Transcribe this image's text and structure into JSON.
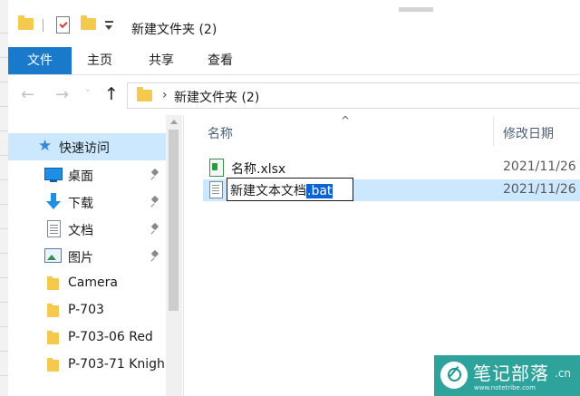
{
  "window": {
    "title": "新建文件夹 (2)"
  },
  "ribbon": {
    "tabs": [
      "文件",
      "主页",
      "共享",
      "查看"
    ],
    "active": "文件"
  },
  "address": {
    "path": [
      "新建文件夹 (2)"
    ]
  },
  "nav_pane": {
    "items": [
      {
        "label": "快速访问",
        "icon": "star-icon",
        "selected": true
      },
      {
        "label": "桌面",
        "icon": "desktop-icon",
        "pinned": true
      },
      {
        "label": "下载",
        "icon": "download-icon",
        "pinned": true
      },
      {
        "label": "文档",
        "icon": "document-icon",
        "pinned": true
      },
      {
        "label": "图片",
        "icon": "picture-icon",
        "pinned": true
      },
      {
        "label": "Camera",
        "icon": "folder-icon"
      },
      {
        "label": "P-703",
        "icon": "folder-icon"
      },
      {
        "label": "P-703-06 Red",
        "icon": "folder-icon"
      },
      {
        "label": "P-703-71 Knigh",
        "icon": "folder-icon"
      }
    ]
  },
  "content": {
    "columns": {
      "name": "名称",
      "date": "修改日期"
    },
    "files": [
      {
        "name": "名称.xlsx",
        "date": "2021/11/26",
        "icon": "excel-file-icon"
      },
      {
        "name_base": "新建文本文档",
        "name_ext": ".bat",
        "date": "2021/11/26",
        "icon": "text-file-icon",
        "renaming": true
      }
    ]
  },
  "watermark": {
    "title": "笔记部落",
    "domain": ".cn",
    "url": "www.notetribe.com"
  }
}
